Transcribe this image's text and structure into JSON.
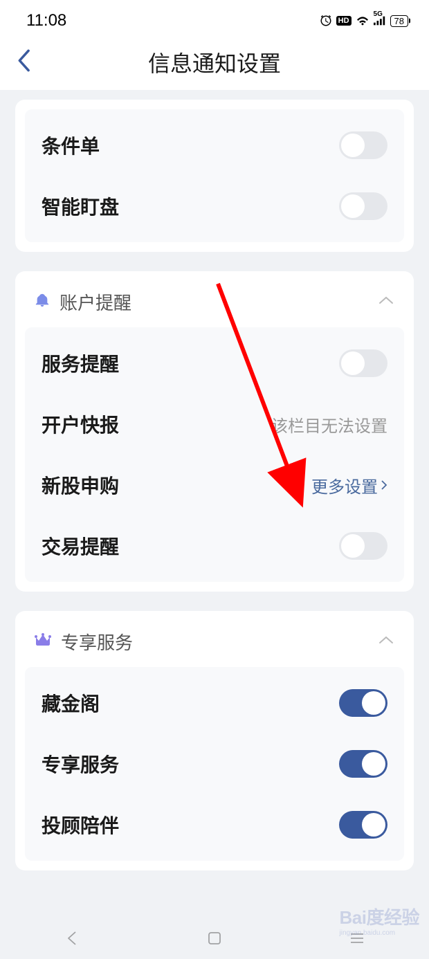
{
  "status": {
    "time": "11:08",
    "hd": "HD",
    "signal": "5G",
    "battery": "78"
  },
  "header": {
    "title": "信息通知设置"
  },
  "card1": {
    "rows": [
      {
        "label": "条件单",
        "type": "toggle",
        "on": false
      },
      {
        "label": "智能盯盘",
        "type": "toggle",
        "on": false
      }
    ]
  },
  "section_account": {
    "title": "账户提醒",
    "rows": [
      {
        "label": "服务提醒",
        "type": "toggle",
        "on": false
      },
      {
        "label": "开户快报",
        "type": "text",
        "text": "该栏目无法设置"
      },
      {
        "label": "新股申购",
        "type": "link",
        "text": "更多设置"
      },
      {
        "label": "交易提醒",
        "type": "toggle",
        "on": false
      }
    ]
  },
  "section_exclusive": {
    "title": "专享服务",
    "rows": [
      {
        "label": "藏金阁",
        "type": "toggle",
        "on": true
      },
      {
        "label": "专享服务",
        "type": "toggle",
        "on": true
      },
      {
        "label": "投顾陪伴",
        "type": "toggle",
        "on": true
      }
    ]
  },
  "watermark": {
    "main": "Bai度经验",
    "sub": "jingyan.baidu.com"
  }
}
